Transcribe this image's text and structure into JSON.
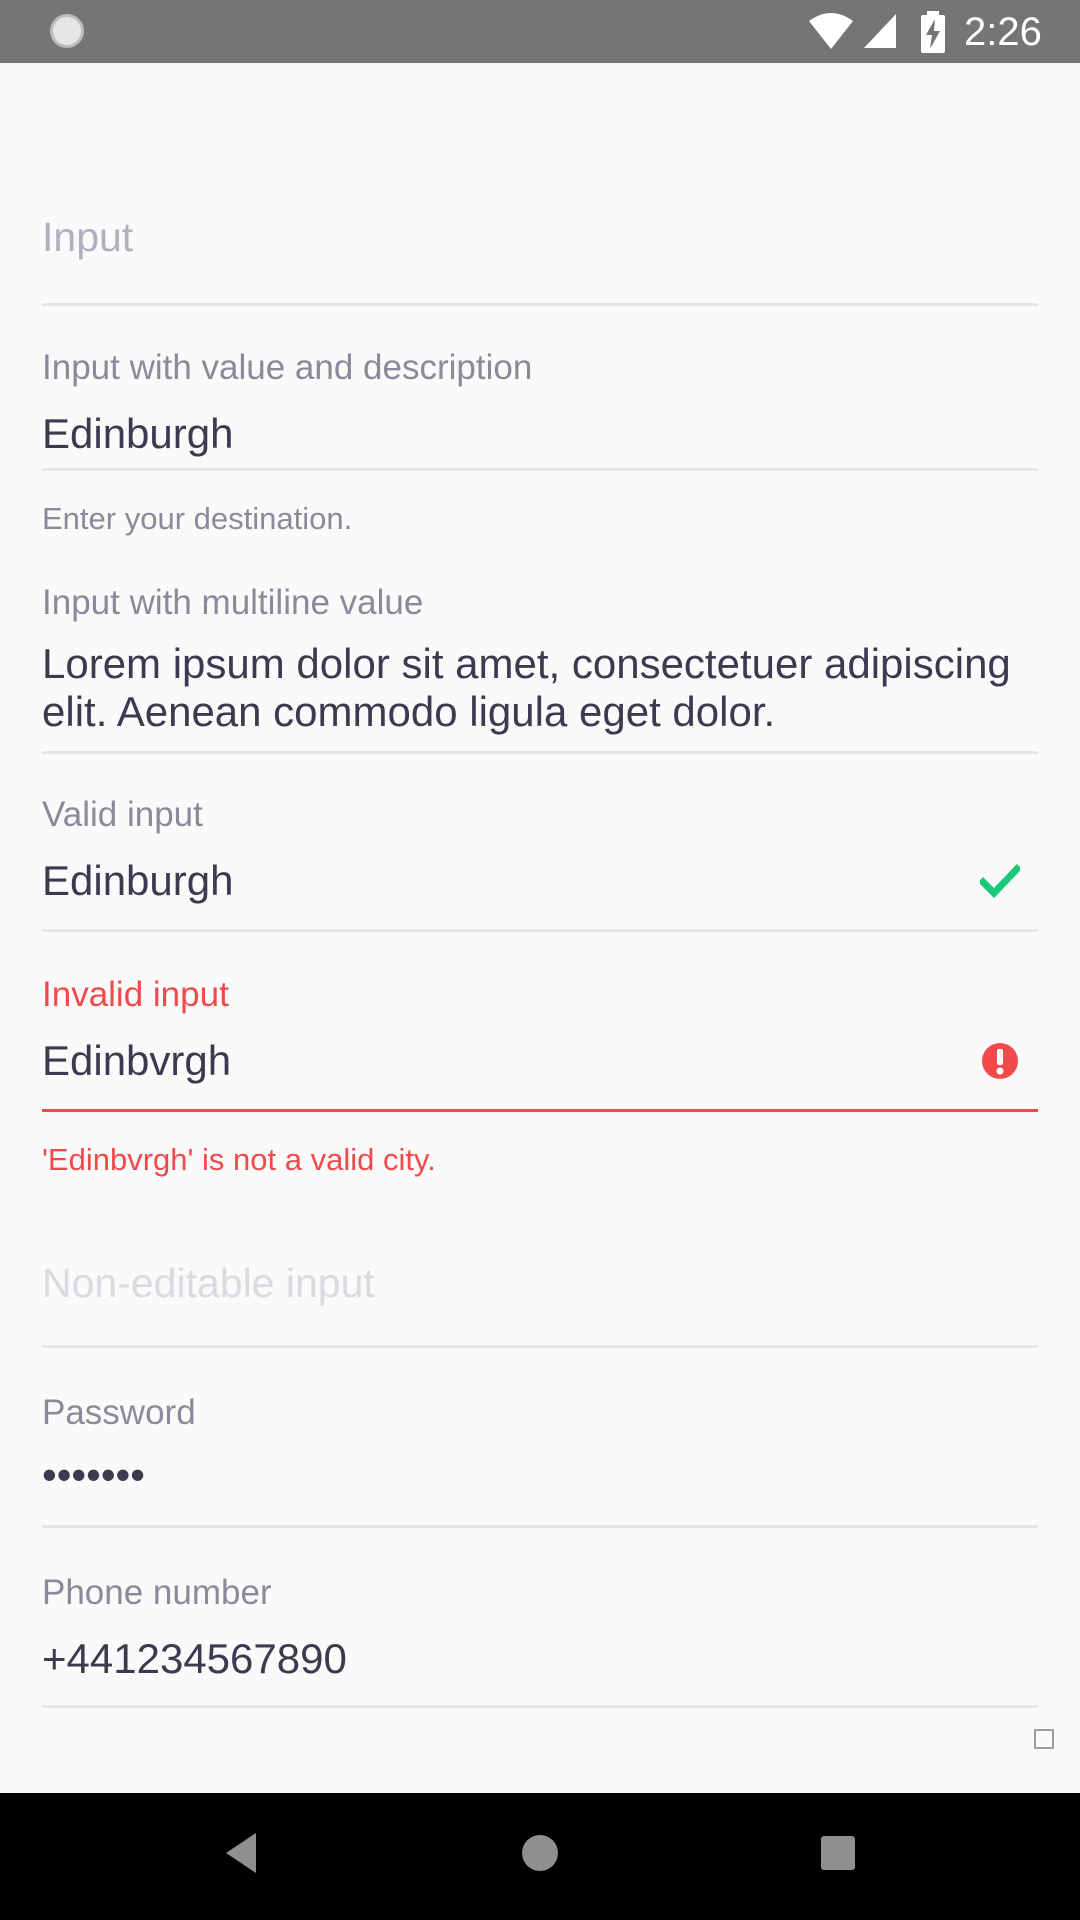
{
  "status_bar": {
    "time": "2:26",
    "icons": [
      "loader-icon",
      "wifi-icon",
      "signal-icon",
      "battery-charging-icon"
    ]
  },
  "fields": {
    "input": {
      "placeholder": "Input"
    },
    "destination": {
      "label": "Input with value and description",
      "value": "Edinburgh",
      "description": "Enter your destination."
    },
    "multiline": {
      "label": "Input with multiline value",
      "value": "Lorem ipsum dolor sit amet, consectetuer adipiscing elit. Aenean commodo ligula eget dolor."
    },
    "valid": {
      "label": "Valid input",
      "value": "Edinburgh",
      "icon": "checkmark-icon"
    },
    "invalid": {
      "label": "Invalid input",
      "value": "Edinbvrgh",
      "error": "'Edinbvrgh' is not a valid city.",
      "icon": "error-icon"
    },
    "non_editable": {
      "placeholder": "Non-editable input"
    },
    "password": {
      "label": "Password",
      "value": "•••••••"
    },
    "phone": {
      "label": "Phone number",
      "value": "+441234567890"
    }
  },
  "colors": {
    "background": "#fafafb",
    "text": "#3d3a4f",
    "label": "#8c8a9a",
    "placeholder": "#b2b0bf",
    "disabled": "#dadae0",
    "divider": "#e5e5ea",
    "error": "#f24a4a",
    "valid": "#19c978",
    "status_bar": "#757575",
    "nav_bar": "#000000"
  },
  "nav_bar": {
    "buttons": [
      "back-icon",
      "home-icon",
      "recents-icon"
    ]
  }
}
